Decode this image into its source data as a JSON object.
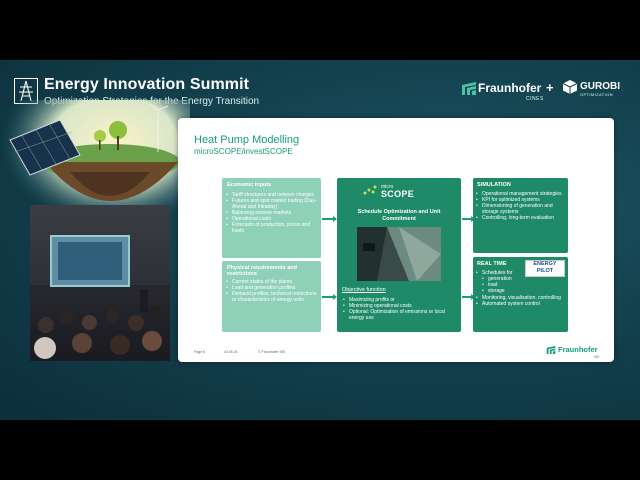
{
  "summit": {
    "title": "Energy Innovation Summit",
    "subtitle": "Optimization Strategies for the Energy Transition"
  },
  "partners": {
    "fraunhofer": "Fraunhofer",
    "fraunhofer_sub": "CINES",
    "plus": "+",
    "gurobi": "GUROBI",
    "gurobi_sub": "OPTIMIZATION"
  },
  "slide": {
    "title": "Heat Pump Modelling",
    "subtitle": "microSCOPE/investSCOPE",
    "economic": {
      "heading": "Economic inputs",
      "items": [
        "Tariff structures and network charges",
        "Futures and spot market trading (Day-Ahead and Intraday)",
        "Balancing reserve markets",
        "Operational costs",
        "Forecasts of production, prices and loads"
      ]
    },
    "physical": {
      "heading": "Physical requirements  and restrictions",
      "items": [
        "Current states of the plants",
        "Load and generation profiles",
        "Demand profiles, technical restrictions or characteristics of energy units"
      ]
    },
    "center": {
      "logo_small": "micro",
      "logo_big": "SCOPE",
      "heading": "Schedule Optimization and Unit Commitment",
      "objective_heading": "Objective function",
      "objective_items": [
        "Maximizing profits or",
        "Minimizing operational costs",
        "Optional: Optimization of  emissions or local energy use"
      ]
    },
    "simulation": {
      "heading": "SIMULATION",
      "items": [
        "Operational management strategies",
        "KPI for optimized systems",
        "Dimensioning of generation and storage systems",
        "Controlling, long-term evaluation"
      ]
    },
    "realtime": {
      "heading": "REAL TIME",
      "schedules": "Schedules for",
      "sub_items": [
        "generation",
        "load",
        "storage"
      ],
      "items": [
        "Monitoring, visualisation, controlling",
        "Automated system control"
      ],
      "badge_top": "ENERGY",
      "badge_bottom": "PILOT"
    },
    "footer": {
      "page": "Page 6",
      "date": "03.06.24",
      "copyright": "© Fraunhofer ISE",
      "brand": "Fraunhofer",
      "brand_sub": "ISE"
    }
  },
  "colors": {
    "teal_dark": "#1f8a68",
    "teal_light": "#8fd0b9",
    "brand_green": "#179c7d",
    "background": "#123e4b"
  }
}
